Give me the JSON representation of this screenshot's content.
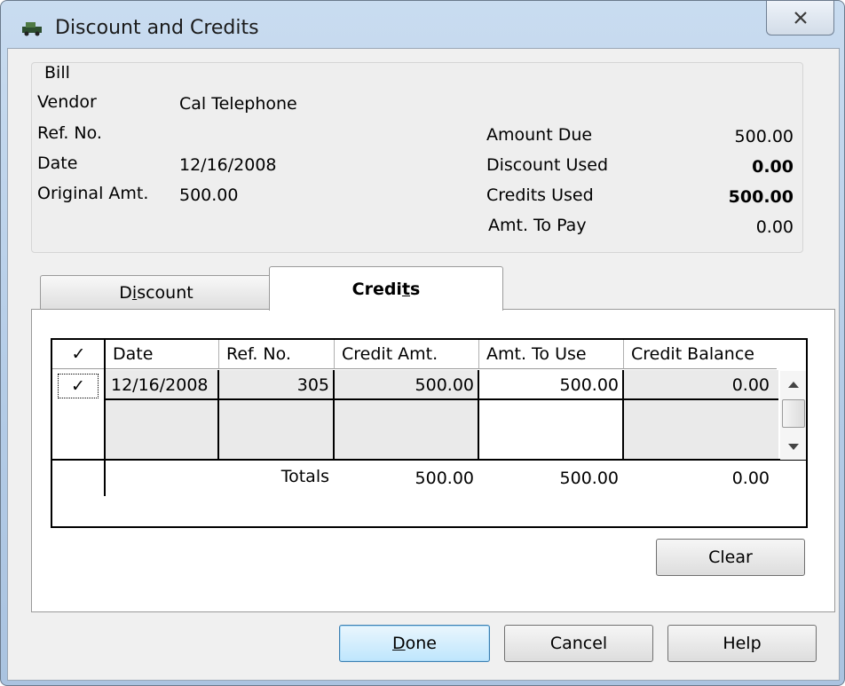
{
  "window": {
    "title": "Discount and Credits"
  },
  "bill": {
    "group_label": "Bill",
    "vendor_label": "Vendor",
    "vendor_value": "Cal Telephone",
    "refno_label": "Ref. No.",
    "date_label": "Date",
    "date_value": "12/16/2008",
    "orig_label": "Original Amt.",
    "orig_value": "500.00",
    "amount_due_label": "Amount Due",
    "amount_due_value": "500.00",
    "discount_used_label": "Discount Used",
    "discount_used_value": "0.00",
    "credits_used_label": "Credits Used",
    "credits_used_value": "500.00",
    "amt_to_pay_label": "Amt. To Pay",
    "amt_to_pay_value": "0.00"
  },
  "tabs": {
    "discount": {
      "pre": "D",
      "ul": "i",
      "post": "scount"
    },
    "credits": {
      "pre": "Credi",
      "ul": "t",
      "post": "s"
    }
  },
  "grid": {
    "headers": {
      "check": "✓",
      "date": "Date",
      "ref": "Ref. No.",
      "credit_amt": "Credit Amt.",
      "amt_use": "Amt. To Use",
      "balance": "Credit Balance"
    },
    "row": {
      "check": "✓",
      "date": "12/16/2008",
      "ref": "305",
      "credit_amt": "500.00",
      "amt_use": "500.00",
      "balance": "0.00"
    },
    "totals": {
      "label": "Totals",
      "credit_amt": "500.00",
      "amt_use": "500.00",
      "balance": "0.00"
    }
  },
  "buttons": {
    "clear": "Clear",
    "done": {
      "ul": "D",
      "post": "one"
    },
    "cancel": "Cancel",
    "help": "Help"
  },
  "icons": {
    "close": "close-icon",
    "title": "vehicle-icon",
    "scroll_up": "scroll-up-icon",
    "scroll_down": "scroll-down-icon"
  }
}
